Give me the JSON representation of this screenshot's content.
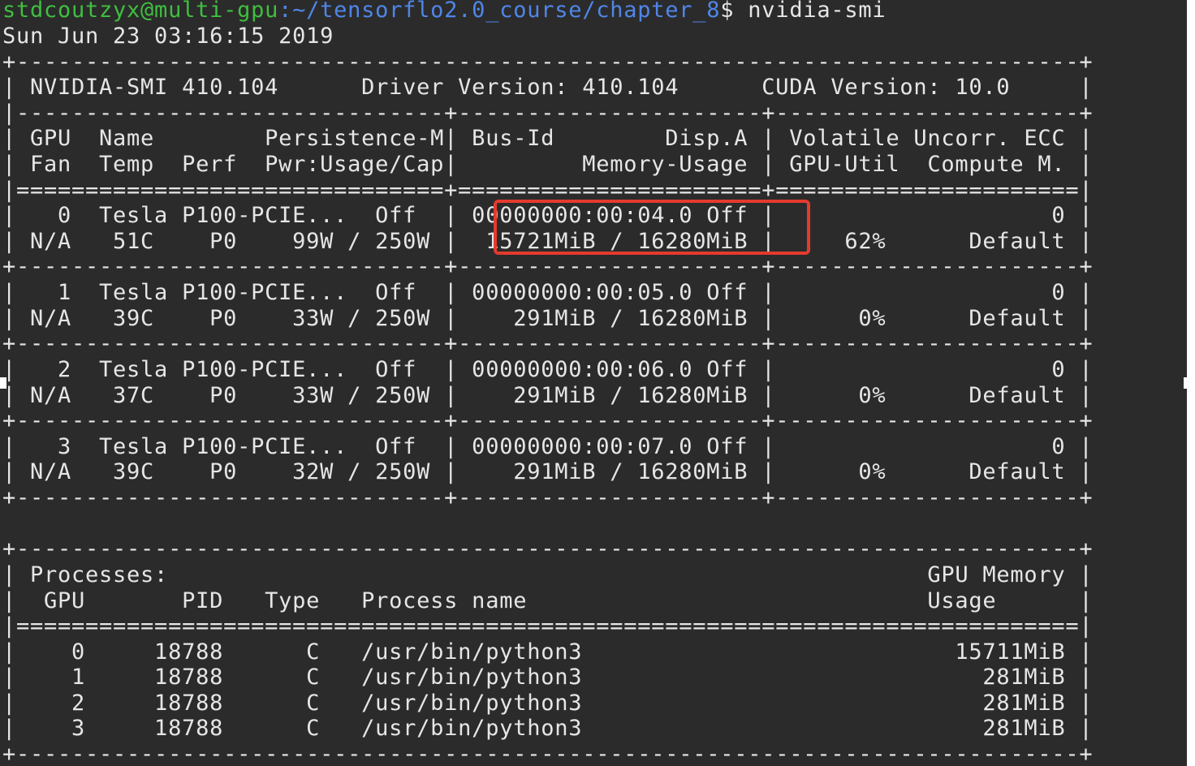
{
  "prompt": {
    "user": "stdcoutzyx@multi-gpu",
    "path": ":~/tensorflo2.0_course/chapter_8",
    "symbol": "$",
    "command": " nvidia-smi"
  },
  "timestamp": "Sun Jun 23 03:16:15 2019",
  "lines": {
    "sep_top": "+-----------------------------------------------------------------------------+",
    "header": "| NVIDIA-SMI 410.104      Driver Version: 410.104      CUDA Version: 10.0     |",
    "sep_cols": "|-------------------------------+----------------------+----------------------+",
    "colhead1": "| GPU  Name        Persistence-M| Bus-Id        Disp.A | Volatile Uncorr. ECC |",
    "colhead2": "| Fan  Temp  Perf  Pwr:Usage/Cap|         Memory-Usage | GPU-Util  Compute M. |",
    "sep_eq": "|===============================+======================+======================|",
    "gpu0_a": "|   0  Tesla P100-PCIE...  Off  | 00000000:00:04.0 Off |                    0 |",
    "gpu0_b": "| N/A   51C    P0    99W / 250W |  15721MiB / 16280MiB |     62%      Default |",
    "sep_row1": "+-------------------------------+----------------------+----------------------+",
    "gpu1_a": "|   1  Tesla P100-PCIE...  Off  | 00000000:00:05.0 Off |                    0 |",
    "gpu1_b": "| N/A   39C    P0    33W / 250W |    291MiB / 16280MiB |      0%      Default |",
    "sep_row2": "+-------------------------------+----------------------+----------------------+",
    "gpu2_a": "|   2  Tesla P100-PCIE...  Off  | 00000000:00:06.0 Off |                    0 |",
    "gpu2_b": "| N/A   37C    P0    33W / 250W |    291MiB / 16280MiB |      0%      Default |",
    "sep_row3": "+-------------------------------+----------------------+----------------------+",
    "gpu3_a": "|   3  Tesla P100-PCIE...  Off  | 00000000:00:07.0 Off |                    0 |",
    "gpu3_b": "| N/A   39C    P0    32W / 250W |    291MiB / 16280MiB |      0%      Default |",
    "sep_row4": "+-------------------------------+----------------------+----------------------+",
    "sep_proc_top": "+-----------------------------------------------------------------------------+",
    "proc_head1": "| Processes:                                                       GPU Memory |",
    "proc_head2": "|  GPU       PID   Type   Process name                             Usage      |",
    "proc_eq": "|=============================================================================|",
    "proc0": "|    0     18788      C   /usr/bin/python3                           15711MiB |",
    "proc1": "|    1     18788      C   /usr/bin/python3                             281MiB |",
    "proc2": "|    2     18788      C   /usr/bin/python3                             281MiB |",
    "proc3": "|    3     18788      C   /usr/bin/python3                             281MiB |",
    "sep_proc_bottom": "+-----------------------------------------------------------------------------+"
  },
  "colors": {
    "background": "#2b2b2b",
    "text": "#e6e6e6",
    "prompt_user": "#3fbf3f",
    "prompt_path": "#4f86e8",
    "highlight_box": "#e33b2e"
  }
}
